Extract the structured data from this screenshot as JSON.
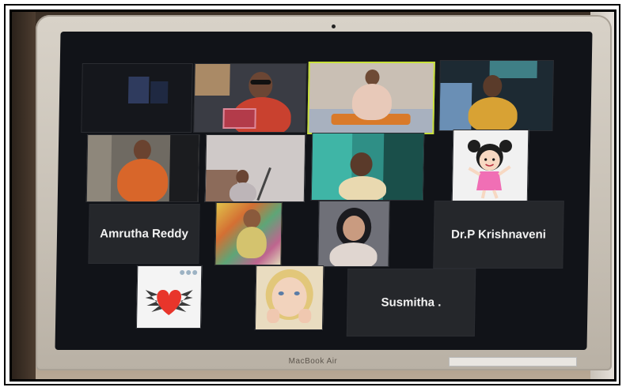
{
  "device": {
    "brand": "MacBook Air"
  },
  "grid": {
    "row3": {
      "name1": "Amrutha Reddy",
      "name2": "Dr.P Krishnaveni"
    },
    "row4": {
      "name1": "Susmitha ."
    }
  },
  "colors": {
    "active_speaker_border": "#c8e03a",
    "tile_background": "#25272b",
    "heart": "#e8352b"
  },
  "icons": {
    "heart": "winged-heart-icon",
    "cartoon": "cartoon-girl-avatar"
  }
}
